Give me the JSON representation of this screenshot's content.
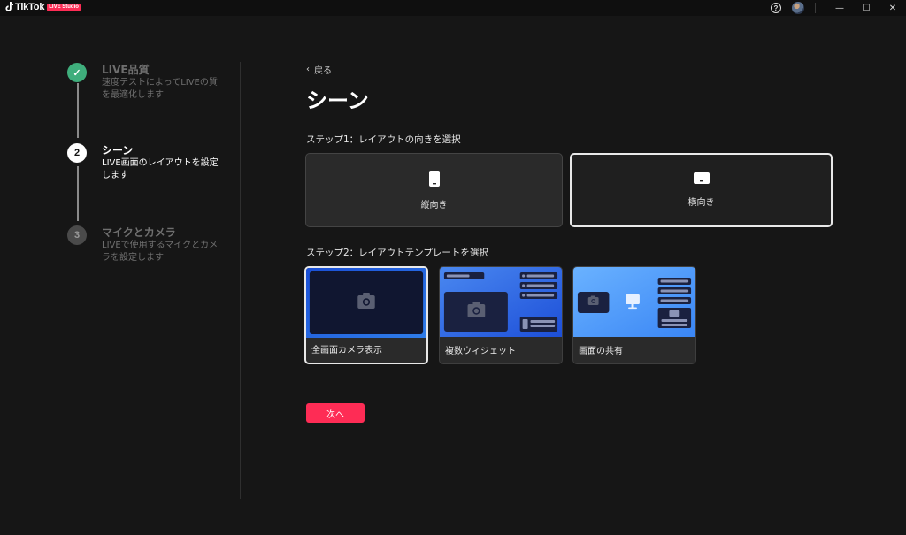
{
  "app": {
    "name": "TikTok",
    "badge": "LIVE Studio"
  },
  "titlebar": {
    "help_glyph": "?",
    "minimize": "—",
    "maximize": "☐",
    "close": "✕"
  },
  "stepper": [
    {
      "number": "✓",
      "state": "done",
      "title": "LIVE品質",
      "desc": "速度テストによってLIVEの質を最適化します"
    },
    {
      "number": "2",
      "state": "active",
      "title": "シーン",
      "desc": "LIVE画面のレイアウトを設定します"
    },
    {
      "number": "3",
      "state": "todo",
      "title": "マイクとカメラ",
      "desc": "LIVEで使用するマイクとカメラを設定します"
    }
  ],
  "main": {
    "back_label": "戻る",
    "title": "シーン",
    "step1_label": "ステップ1：レイアウトの向きを選択",
    "orientations": [
      {
        "label": "縦向き",
        "icon": "portrait-phone-icon",
        "selected": false
      },
      {
        "label": "横向き",
        "icon": "landscape-screen-icon",
        "selected": true
      }
    ],
    "step2_label": "ステップ2：レイアウトテンプレートを選択",
    "templates": [
      {
        "label": "全画面カメラ表示",
        "selected": true
      },
      {
        "label": "複数ウィジェット",
        "selected": false
      },
      {
        "label": "画面の共有",
        "selected": false
      }
    ],
    "next_label": "次へ"
  },
  "colors": {
    "accent": "#fe2c55",
    "done": "#3fae7c",
    "background": "#161616",
    "card": "#2a2a2a"
  }
}
